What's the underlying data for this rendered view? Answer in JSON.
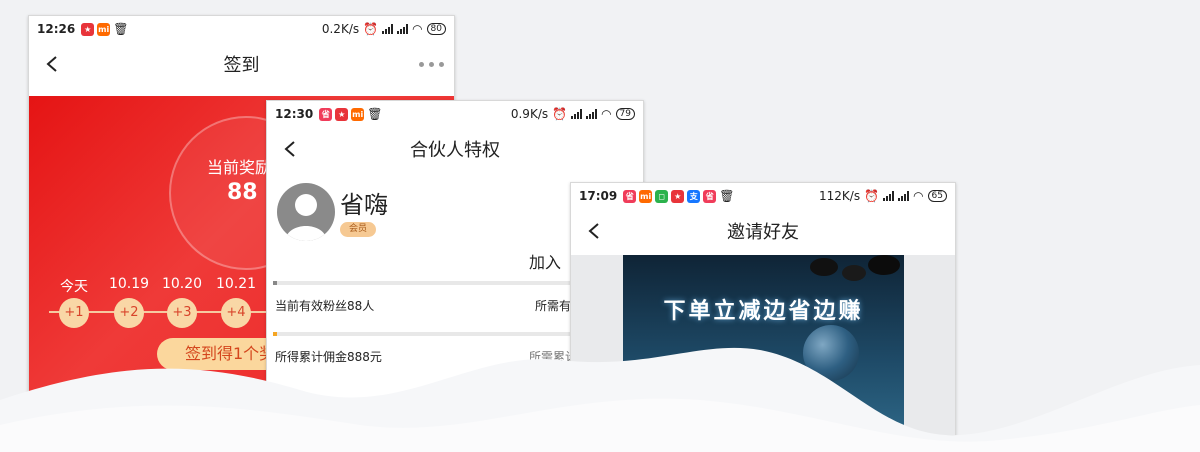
{
  "phone1": {
    "status": {
      "time": "12:26",
      "speed": "0.2K/s",
      "battery": "80"
    },
    "title": "签到",
    "reward_label": "当前奖励",
    "reward_value": "88",
    "days": [
      "今天",
      "10.19",
      "10.20",
      "10.21"
    ],
    "points": [
      "+1",
      "+2",
      "+3",
      "+4"
    ],
    "sign_button": "签到得1个奖",
    "colors": {
      "accent": "#e51414",
      "dot": "#f9d7a6"
    }
  },
  "phone2": {
    "status": {
      "time": "12:30",
      "speed": "0.9K/s",
      "battery": "79"
    },
    "title": "合伙人特权",
    "user_name": "省嗨",
    "badge": "会员",
    "join_text": "加入",
    "fans_text": "当前有效粉丝88人",
    "fans_required": "所需有",
    "commission_text": "所得累计佣金888元",
    "commission_required": "所需累计",
    "fans_progress": 0.01,
    "commission_progress": 0.01
  },
  "phone3": {
    "status": {
      "time": "17:09",
      "speed": "112K/s",
      "battery": "65"
    },
    "title": "邀请好友",
    "poster_title": "下单立减边省边赚"
  }
}
